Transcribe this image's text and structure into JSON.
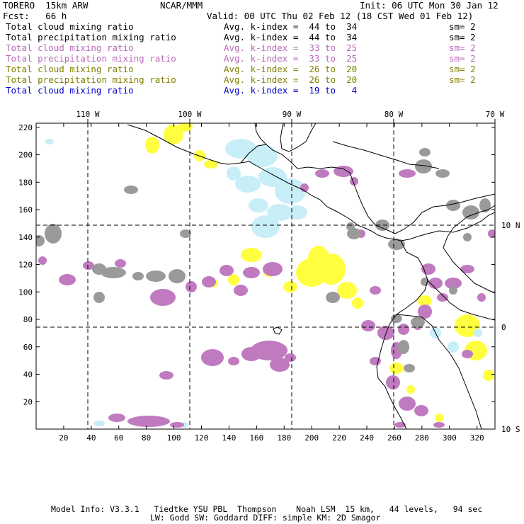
{
  "header": {
    "model_name": "TORERO  15km ARW",
    "org": "NCAR/MMM",
    "init": "Init: 06 UTC Mon 30 Jan 12",
    "fcst": "Fcst:   66 h",
    "valid": "Valid: 00 UTC Thu 02 Feb 12 (18 CST Wed 01 Feb 12)"
  },
  "legend": [
    {
      "field": "Total cloud mixing ratio",
      "kindex": "Avg. k-index =  44 to  34",
      "sm": "sm= 2",
      "color": "#000000"
    },
    {
      "field": "Total precipitation mixing ratio",
      "kindex": "Avg. k-index =  44 to  34",
      "sm": "sm= 2",
      "color": "#000000"
    },
    {
      "field": "Total cloud mixing ratio",
      "kindex": "Avg. k-index =  33 to  25",
      "sm": "sm= 2",
      "color": "#b86ab8"
    },
    {
      "field": "Total precipitation mixing ratio",
      "kindex": "Avg. k-index =  33 to  25",
      "sm": "sm= 2",
      "color": "#b86ab8"
    },
    {
      "field": "Total cloud mixing ratio",
      "kindex": "Avg. k-index =  26 to  20",
      "sm": "sm= 2",
      "color": "#808000"
    },
    {
      "field": "Total precipitation mixing ratio",
      "kindex": "Avg. k-index =  26 to  20",
      "sm": "sm= 2",
      "color": "#808000"
    },
    {
      "field": "Total cloud mixing ratio",
      "kindex": "Avg. k-index =  19 to   4",
      "sm": "",
      "color": "#0000cc"
    }
  ],
  "map": {
    "lon_labels": [
      "110 W",
      "100 W",
      "90 W",
      "80 W",
      "70 W"
    ],
    "lat_labels": [
      "10 N",
      "0",
      "10 S"
    ],
    "x_ticks": [
      "20",
      "40",
      "60",
      "80",
      "100",
      "120",
      "140",
      "160",
      "180",
      "200",
      "220",
      "240",
      "260",
      "280",
      "300",
      "320"
    ],
    "y_ticks": [
      "220",
      "200",
      "180",
      "160",
      "140",
      "120",
      "100",
      "80",
      "60",
      "40",
      "20"
    ],
    "colors": {
      "cloud_gray": "#9a9a9a",
      "purple": "#c07ac0",
      "yellow": "#ffff40",
      "light_blue": "#c8eef8",
      "coast": "#000000",
      "grid": "#000000"
    }
  },
  "footer": {
    "line1": "Model Info: V3.3.1   Tiedtke YSU PBL  Thompson    Noah LSM  15 km,   44 levels,   94 sec",
    "line2": "LW: Godd SW: Goddard DIFF: simple KM: 2D Smagor"
  }
}
